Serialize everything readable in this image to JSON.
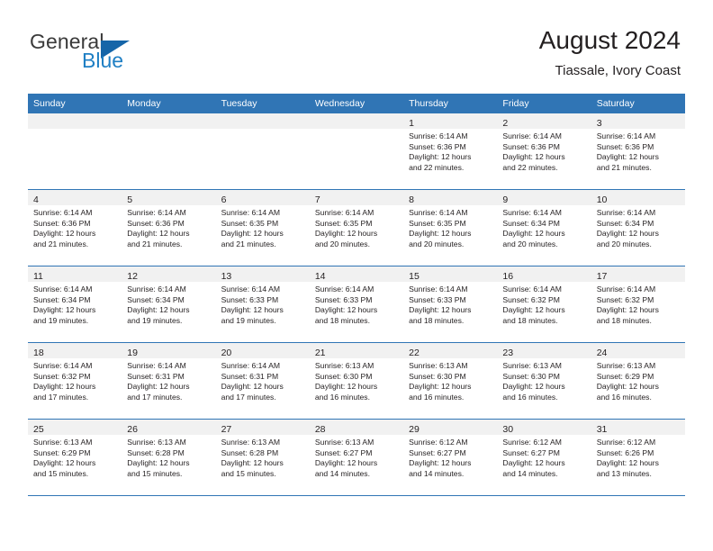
{
  "brand": {
    "name_top": "General",
    "name_bottom": "Blue",
    "triangle_color": "#1565a8",
    "blue_color": "#1f7fc4"
  },
  "header": {
    "title": "August 2024",
    "subtitle": "Tiassale, Ivory Coast"
  },
  "theme": {
    "header_bg": "#3075b5",
    "daynum_bg": "#f1f1f1",
    "row_border": "#3075b5",
    "text": "#231f20"
  },
  "weekdays": [
    "Sunday",
    "Monday",
    "Tuesday",
    "Wednesday",
    "Thursday",
    "Friday",
    "Saturday"
  ],
  "labels": {
    "sunrise_prefix": "Sunrise: ",
    "sunset_prefix": "Sunset: ",
    "daylight_prefix": "Daylight: "
  },
  "weeks": [
    [
      {
        "empty": true
      },
      {
        "empty": true
      },
      {
        "empty": true
      },
      {
        "empty": true
      },
      {
        "day": "1",
        "sunrise": "Sunrise: 6:14 AM",
        "sunset": "Sunset: 6:36 PM",
        "daylight_1": "Daylight: 12 hours",
        "daylight_2": "and 22 minutes."
      },
      {
        "day": "2",
        "sunrise": "Sunrise: 6:14 AM",
        "sunset": "Sunset: 6:36 PM",
        "daylight_1": "Daylight: 12 hours",
        "daylight_2": "and 22 minutes."
      },
      {
        "day": "3",
        "sunrise": "Sunrise: 6:14 AM",
        "sunset": "Sunset: 6:36 PM",
        "daylight_1": "Daylight: 12 hours",
        "daylight_2": "and 21 minutes."
      }
    ],
    [
      {
        "day": "4",
        "sunrise": "Sunrise: 6:14 AM",
        "sunset": "Sunset: 6:36 PM",
        "daylight_1": "Daylight: 12 hours",
        "daylight_2": "and 21 minutes."
      },
      {
        "day": "5",
        "sunrise": "Sunrise: 6:14 AM",
        "sunset": "Sunset: 6:36 PM",
        "daylight_1": "Daylight: 12 hours",
        "daylight_2": "and 21 minutes."
      },
      {
        "day": "6",
        "sunrise": "Sunrise: 6:14 AM",
        "sunset": "Sunset: 6:35 PM",
        "daylight_1": "Daylight: 12 hours",
        "daylight_2": "and 21 minutes."
      },
      {
        "day": "7",
        "sunrise": "Sunrise: 6:14 AM",
        "sunset": "Sunset: 6:35 PM",
        "daylight_1": "Daylight: 12 hours",
        "daylight_2": "and 20 minutes."
      },
      {
        "day": "8",
        "sunrise": "Sunrise: 6:14 AM",
        "sunset": "Sunset: 6:35 PM",
        "daylight_1": "Daylight: 12 hours",
        "daylight_2": "and 20 minutes."
      },
      {
        "day": "9",
        "sunrise": "Sunrise: 6:14 AM",
        "sunset": "Sunset: 6:34 PM",
        "daylight_1": "Daylight: 12 hours",
        "daylight_2": "and 20 minutes."
      },
      {
        "day": "10",
        "sunrise": "Sunrise: 6:14 AM",
        "sunset": "Sunset: 6:34 PM",
        "daylight_1": "Daylight: 12 hours",
        "daylight_2": "and 20 minutes."
      }
    ],
    [
      {
        "day": "11",
        "sunrise": "Sunrise: 6:14 AM",
        "sunset": "Sunset: 6:34 PM",
        "daylight_1": "Daylight: 12 hours",
        "daylight_2": "and 19 minutes."
      },
      {
        "day": "12",
        "sunrise": "Sunrise: 6:14 AM",
        "sunset": "Sunset: 6:34 PM",
        "daylight_1": "Daylight: 12 hours",
        "daylight_2": "and 19 minutes."
      },
      {
        "day": "13",
        "sunrise": "Sunrise: 6:14 AM",
        "sunset": "Sunset: 6:33 PM",
        "daylight_1": "Daylight: 12 hours",
        "daylight_2": "and 19 minutes."
      },
      {
        "day": "14",
        "sunrise": "Sunrise: 6:14 AM",
        "sunset": "Sunset: 6:33 PM",
        "daylight_1": "Daylight: 12 hours",
        "daylight_2": "and 18 minutes."
      },
      {
        "day": "15",
        "sunrise": "Sunrise: 6:14 AM",
        "sunset": "Sunset: 6:33 PM",
        "daylight_1": "Daylight: 12 hours",
        "daylight_2": "and 18 minutes."
      },
      {
        "day": "16",
        "sunrise": "Sunrise: 6:14 AM",
        "sunset": "Sunset: 6:32 PM",
        "daylight_1": "Daylight: 12 hours",
        "daylight_2": "and 18 minutes."
      },
      {
        "day": "17",
        "sunrise": "Sunrise: 6:14 AM",
        "sunset": "Sunset: 6:32 PM",
        "daylight_1": "Daylight: 12 hours",
        "daylight_2": "and 18 minutes."
      }
    ],
    [
      {
        "day": "18",
        "sunrise": "Sunrise: 6:14 AM",
        "sunset": "Sunset: 6:32 PM",
        "daylight_1": "Daylight: 12 hours",
        "daylight_2": "and 17 minutes."
      },
      {
        "day": "19",
        "sunrise": "Sunrise: 6:14 AM",
        "sunset": "Sunset: 6:31 PM",
        "daylight_1": "Daylight: 12 hours",
        "daylight_2": "and 17 minutes."
      },
      {
        "day": "20",
        "sunrise": "Sunrise: 6:14 AM",
        "sunset": "Sunset: 6:31 PM",
        "daylight_1": "Daylight: 12 hours",
        "daylight_2": "and 17 minutes."
      },
      {
        "day": "21",
        "sunrise": "Sunrise: 6:13 AM",
        "sunset": "Sunset: 6:30 PM",
        "daylight_1": "Daylight: 12 hours",
        "daylight_2": "and 16 minutes."
      },
      {
        "day": "22",
        "sunrise": "Sunrise: 6:13 AM",
        "sunset": "Sunset: 6:30 PM",
        "daylight_1": "Daylight: 12 hours",
        "daylight_2": "and 16 minutes."
      },
      {
        "day": "23",
        "sunrise": "Sunrise: 6:13 AM",
        "sunset": "Sunset: 6:30 PM",
        "daylight_1": "Daylight: 12 hours",
        "daylight_2": "and 16 minutes."
      },
      {
        "day": "24",
        "sunrise": "Sunrise: 6:13 AM",
        "sunset": "Sunset: 6:29 PM",
        "daylight_1": "Daylight: 12 hours",
        "daylight_2": "and 16 minutes."
      }
    ],
    [
      {
        "day": "25",
        "sunrise": "Sunrise: 6:13 AM",
        "sunset": "Sunset: 6:29 PM",
        "daylight_1": "Daylight: 12 hours",
        "daylight_2": "and 15 minutes."
      },
      {
        "day": "26",
        "sunrise": "Sunrise: 6:13 AM",
        "sunset": "Sunset: 6:28 PM",
        "daylight_1": "Daylight: 12 hours",
        "daylight_2": "and 15 minutes."
      },
      {
        "day": "27",
        "sunrise": "Sunrise: 6:13 AM",
        "sunset": "Sunset: 6:28 PM",
        "daylight_1": "Daylight: 12 hours",
        "daylight_2": "and 15 minutes."
      },
      {
        "day": "28",
        "sunrise": "Sunrise: 6:13 AM",
        "sunset": "Sunset: 6:27 PM",
        "daylight_1": "Daylight: 12 hours",
        "daylight_2": "and 14 minutes."
      },
      {
        "day": "29",
        "sunrise": "Sunrise: 6:12 AM",
        "sunset": "Sunset: 6:27 PM",
        "daylight_1": "Daylight: 12 hours",
        "daylight_2": "and 14 minutes."
      },
      {
        "day": "30",
        "sunrise": "Sunrise: 6:12 AM",
        "sunset": "Sunset: 6:27 PM",
        "daylight_1": "Daylight: 12 hours",
        "daylight_2": "and 14 minutes."
      },
      {
        "day": "31",
        "sunrise": "Sunrise: 6:12 AM",
        "sunset": "Sunset: 6:26 PM",
        "daylight_1": "Daylight: 12 hours",
        "daylight_2": "and 13 minutes."
      }
    ]
  ]
}
